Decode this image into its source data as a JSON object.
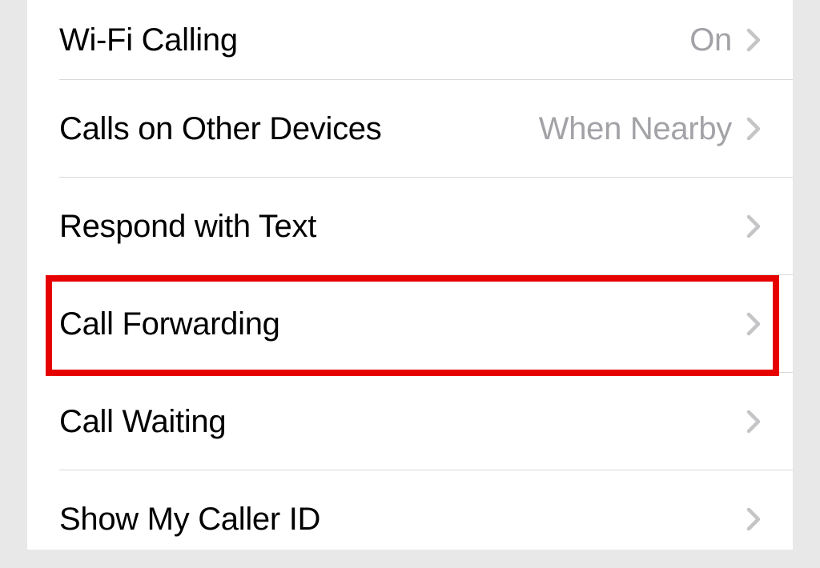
{
  "settings": {
    "rows": [
      {
        "label": "Wi-Fi Calling",
        "value": "On"
      },
      {
        "label": "Calls on Other Devices",
        "value": "When Nearby"
      },
      {
        "label": "Respond with Text",
        "value": ""
      },
      {
        "label": "Call Forwarding",
        "value": ""
      },
      {
        "label": "Call Waiting",
        "value": ""
      },
      {
        "label": "Show My Caller ID",
        "value": ""
      }
    ]
  },
  "highlight": {
    "target": "call-forwarding-row",
    "color": "#e60000"
  }
}
